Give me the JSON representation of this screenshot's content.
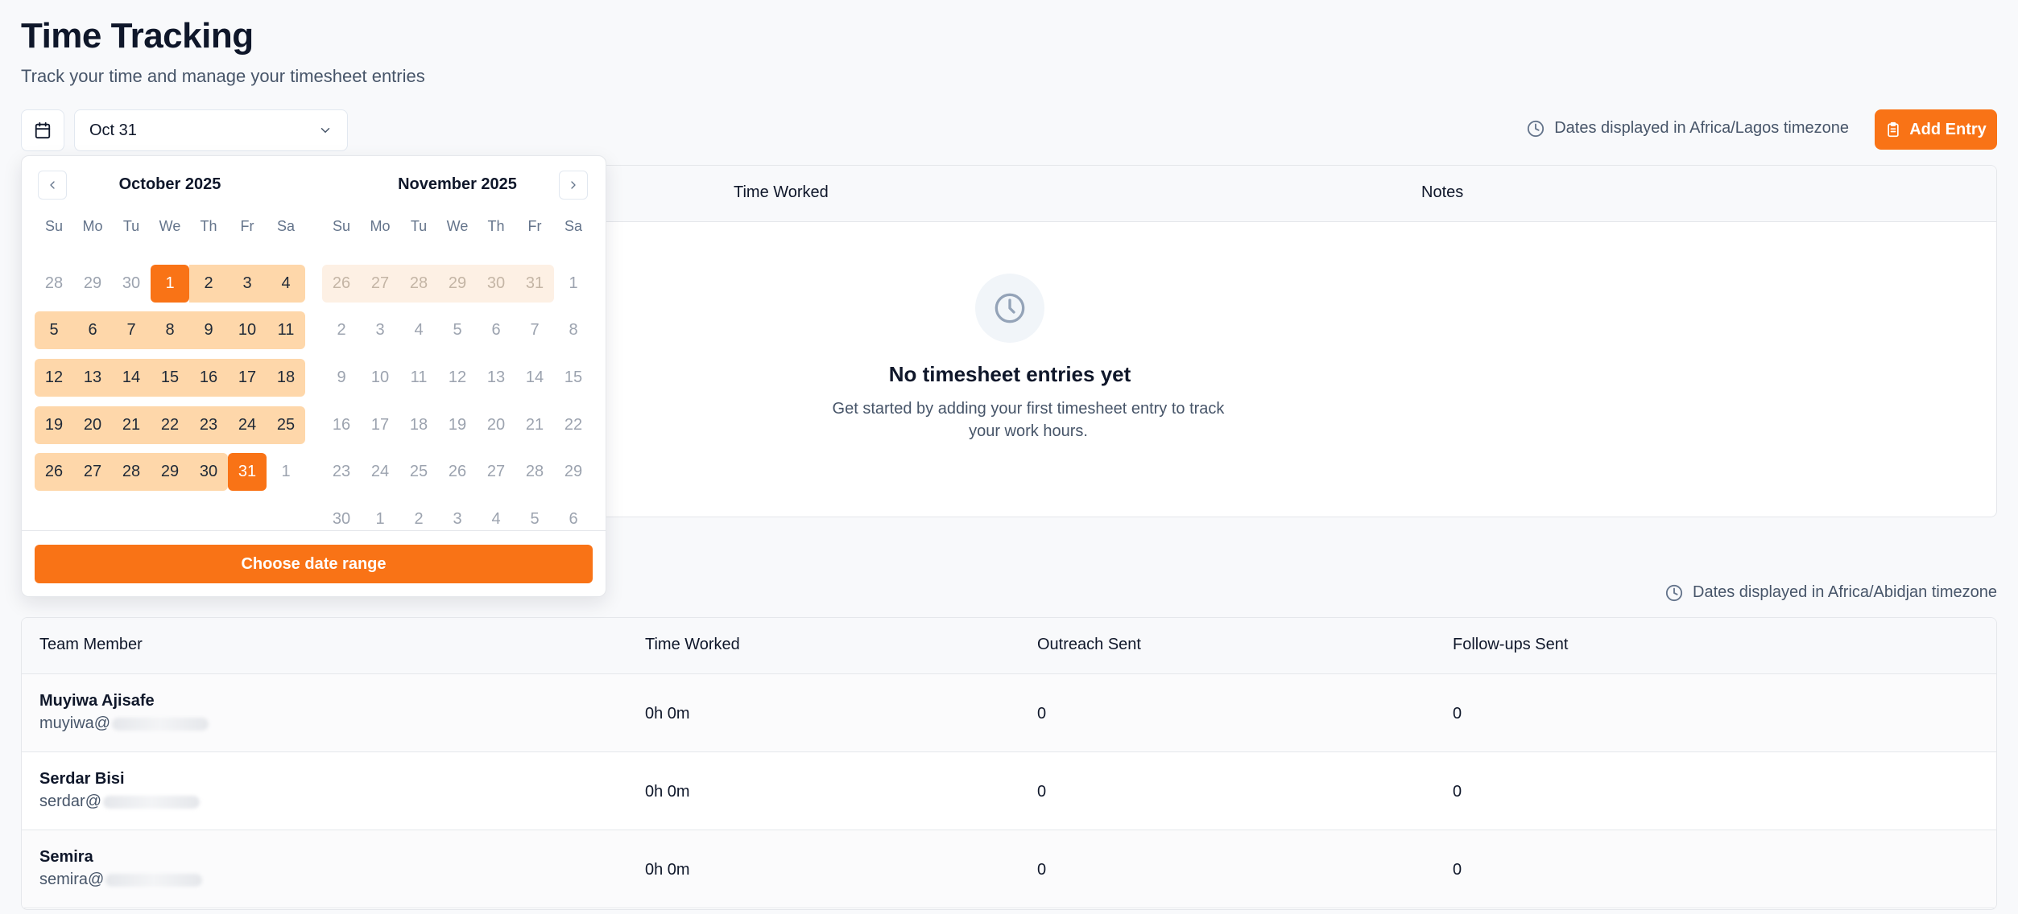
{
  "header": {
    "title": "Time Tracking",
    "subtitle": "Track your time and manage your timesheet entries"
  },
  "toolbar": {
    "date_value": "Oct 31",
    "timezone_note": "Dates displayed in Africa/Lagos timezone",
    "add_entry_label": "Add Entry"
  },
  "entries_table": {
    "col_time_worked": "Time Worked",
    "col_notes": "Notes",
    "empty_title": "No timesheet entries yet",
    "empty_desc": "Get started by adding your first timesheet entry to track your work hours."
  },
  "calendar": {
    "left_month": "October 2025",
    "right_month": "November 2025",
    "weekdays": [
      "Su",
      "Mo",
      "Tu",
      "We",
      "Th",
      "Fr",
      "Sa"
    ],
    "left_days": [
      "28",
      "29",
      "30",
      "1",
      "2",
      "3",
      "4",
      "5",
      "6",
      "7",
      "8",
      "9",
      "10",
      "11",
      "12",
      "13",
      "14",
      "15",
      "16",
      "17",
      "18",
      "19",
      "20",
      "21",
      "22",
      "23",
      "24",
      "25",
      "26",
      "27",
      "28",
      "29",
      "30",
      "31",
      "1"
    ],
    "right_days": [
      "26",
      "27",
      "28",
      "29",
      "30",
      "31",
      "1",
      "2",
      "3",
      "4",
      "5",
      "6",
      "7",
      "8",
      "9",
      "10",
      "11",
      "12",
      "13",
      "14",
      "15",
      "16",
      "17",
      "18",
      "19",
      "20",
      "21",
      "22",
      "23",
      "24",
      "25",
      "26",
      "27",
      "28",
      "29",
      "30",
      "1",
      "2",
      "3",
      "4",
      "5",
      "6"
    ],
    "range_start": "1",
    "range_end": "31",
    "choose_label": "Choose date range"
  },
  "team": {
    "timezone_note": "Dates displayed in Africa/Abidjan timezone",
    "columns": [
      "Team Member",
      "Time Worked",
      "Outreach Sent",
      "Follow-ups Sent"
    ],
    "rows": [
      {
        "name": "Muyiwa Ajisafe",
        "email": "muyiwa@",
        "time": "0h 0m",
        "outreach": "0",
        "followups": "0"
      },
      {
        "name": "Serdar Bisi",
        "email": "serdar@",
        "time": "0h 0m",
        "outreach": "0",
        "followups": "0"
      },
      {
        "name": "Semira",
        "email": "semira@",
        "time": "0h 0m",
        "outreach": "0",
        "followups": "0"
      }
    ]
  },
  "colors": {
    "accent": "#f97316",
    "range_fill": "#fed7aa"
  },
  "icons": {
    "calendar": "calendar-icon",
    "chevron": "chevron-down-icon",
    "clock": "clock-icon",
    "clipboard": "clipboard-icon"
  }
}
